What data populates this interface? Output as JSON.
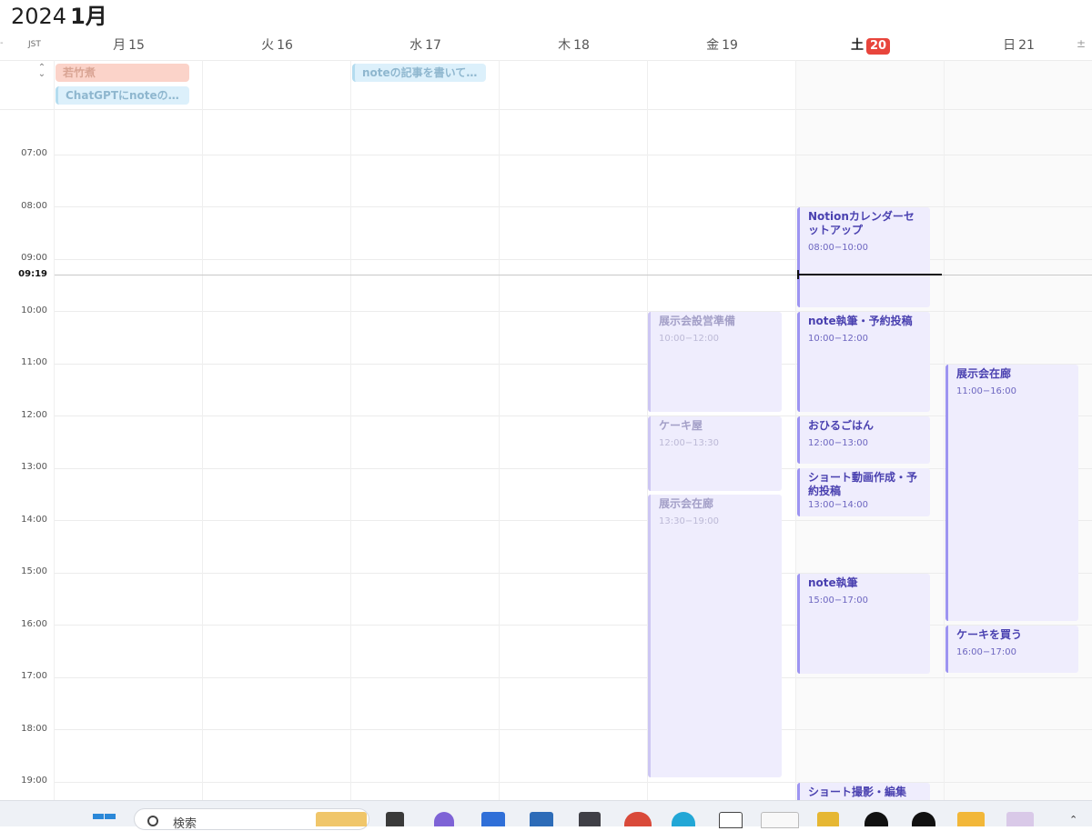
{
  "header": {
    "year": "2024",
    "month": "1月",
    "timezone": "JST"
  },
  "days": [
    {
      "dow": "月",
      "date": "15",
      "today": false
    },
    {
      "dow": "火",
      "date": "16",
      "today": false
    },
    {
      "dow": "水",
      "date": "17",
      "today": false
    },
    {
      "dow": "木",
      "date": "18",
      "today": false
    },
    {
      "dow": "金",
      "date": "19",
      "today": false
    },
    {
      "dow": "土",
      "date": "20",
      "today": true
    },
    {
      "dow": "日",
      "date": "21",
      "today": false
    }
  ],
  "all_day_events": [
    {
      "title": "若竹煮",
      "day": "月15",
      "color": "#fbd3c9"
    },
    {
      "title": "ChatGPTにnoteのア...",
      "day": "月15",
      "color": "#dcf0fb"
    },
    {
      "title": "noteの記事を書いてよ...",
      "day": "水17",
      "color": "#dcf0fb"
    }
  ],
  "hours": [
    "07:00",
    "08:00",
    "09:00",
    "10:00",
    "11:00",
    "12:00",
    "13:00",
    "14:00",
    "15:00",
    "16:00",
    "17:00",
    "18:00",
    "19:00"
  ],
  "now": "09:19",
  "events": {
    "fri": [
      {
        "title": "展示会設営準備",
        "time": "10:00−12:00"
      },
      {
        "title": "ケーキ屋",
        "time": "12:00−13:30"
      },
      {
        "title": "展示会在廊",
        "time": "13:30−19:00"
      }
    ],
    "sat": [
      {
        "title": "Notionカレンダーセットアップ",
        "time": "08:00−10:00"
      },
      {
        "title": "note執筆・予約投稿",
        "time": "10:00−12:00"
      },
      {
        "title": "おひるごはん",
        "time": "12:00−13:00"
      },
      {
        "title": "ショート動画作成・予約投稿",
        "time": "13:00−14:00"
      },
      {
        "title": "note執筆",
        "time": "15:00−17:00"
      },
      {
        "title": "ショート撮影・編集",
        "time": ""
      }
    ],
    "sun": [
      {
        "title": "展示会在廊",
        "time": "11:00−16:00"
      },
      {
        "title": "ケーキを買う",
        "time": "16:00−17:00"
      }
    ]
  },
  "taskbar": {
    "search_placeholder": "検索"
  },
  "colors": {
    "accent": "#9d94f1",
    "today_badge": "#e8453c",
    "event_bg": "#efedfd"
  }
}
